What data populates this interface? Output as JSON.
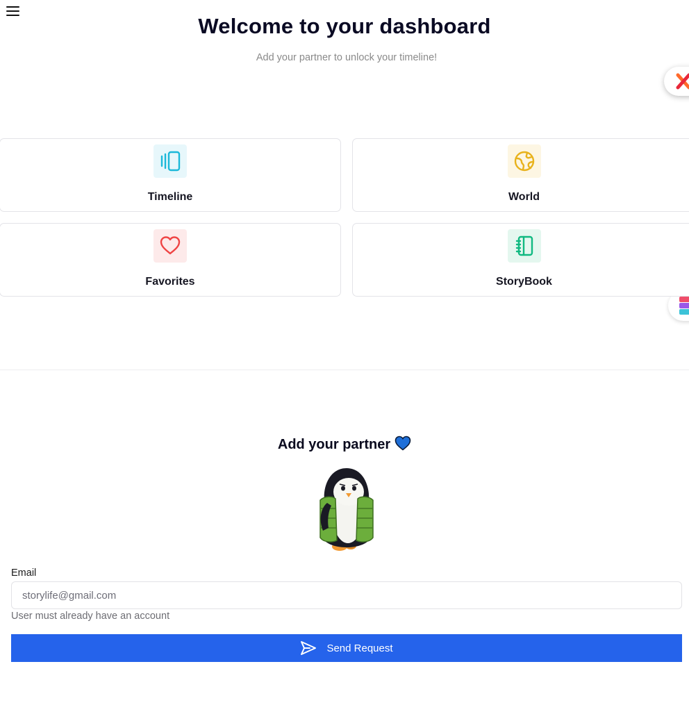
{
  "header": {
    "title": "Welcome to your dashboard",
    "subtitle": "Add your partner to unlock your timeline!"
  },
  "cards": [
    {
      "label": "Timeline",
      "icon": "timeline-icon",
      "color": "#1bb8d9",
      "bg": "#e7f7fb"
    },
    {
      "label": "World",
      "icon": "globe-icon",
      "color": "#e8b21c",
      "bg": "#fdf6e3"
    },
    {
      "label": "Favorites",
      "icon": "heart-icon",
      "color": "#ef4444",
      "bg": "#fdeaea"
    },
    {
      "label": "StoryBook",
      "icon": "notebook-icon",
      "color": "#10b981",
      "bg": "#e4f7ef"
    }
  ],
  "partner": {
    "title": "Add your partner",
    "email_label": "Email",
    "email_placeholder": "storylife@gmail.com",
    "email_value": "",
    "helper": "User must already have an account",
    "button_label": "Send Request"
  },
  "colors": {
    "primary": "#2563eb",
    "heart": "#1e6fd9"
  }
}
